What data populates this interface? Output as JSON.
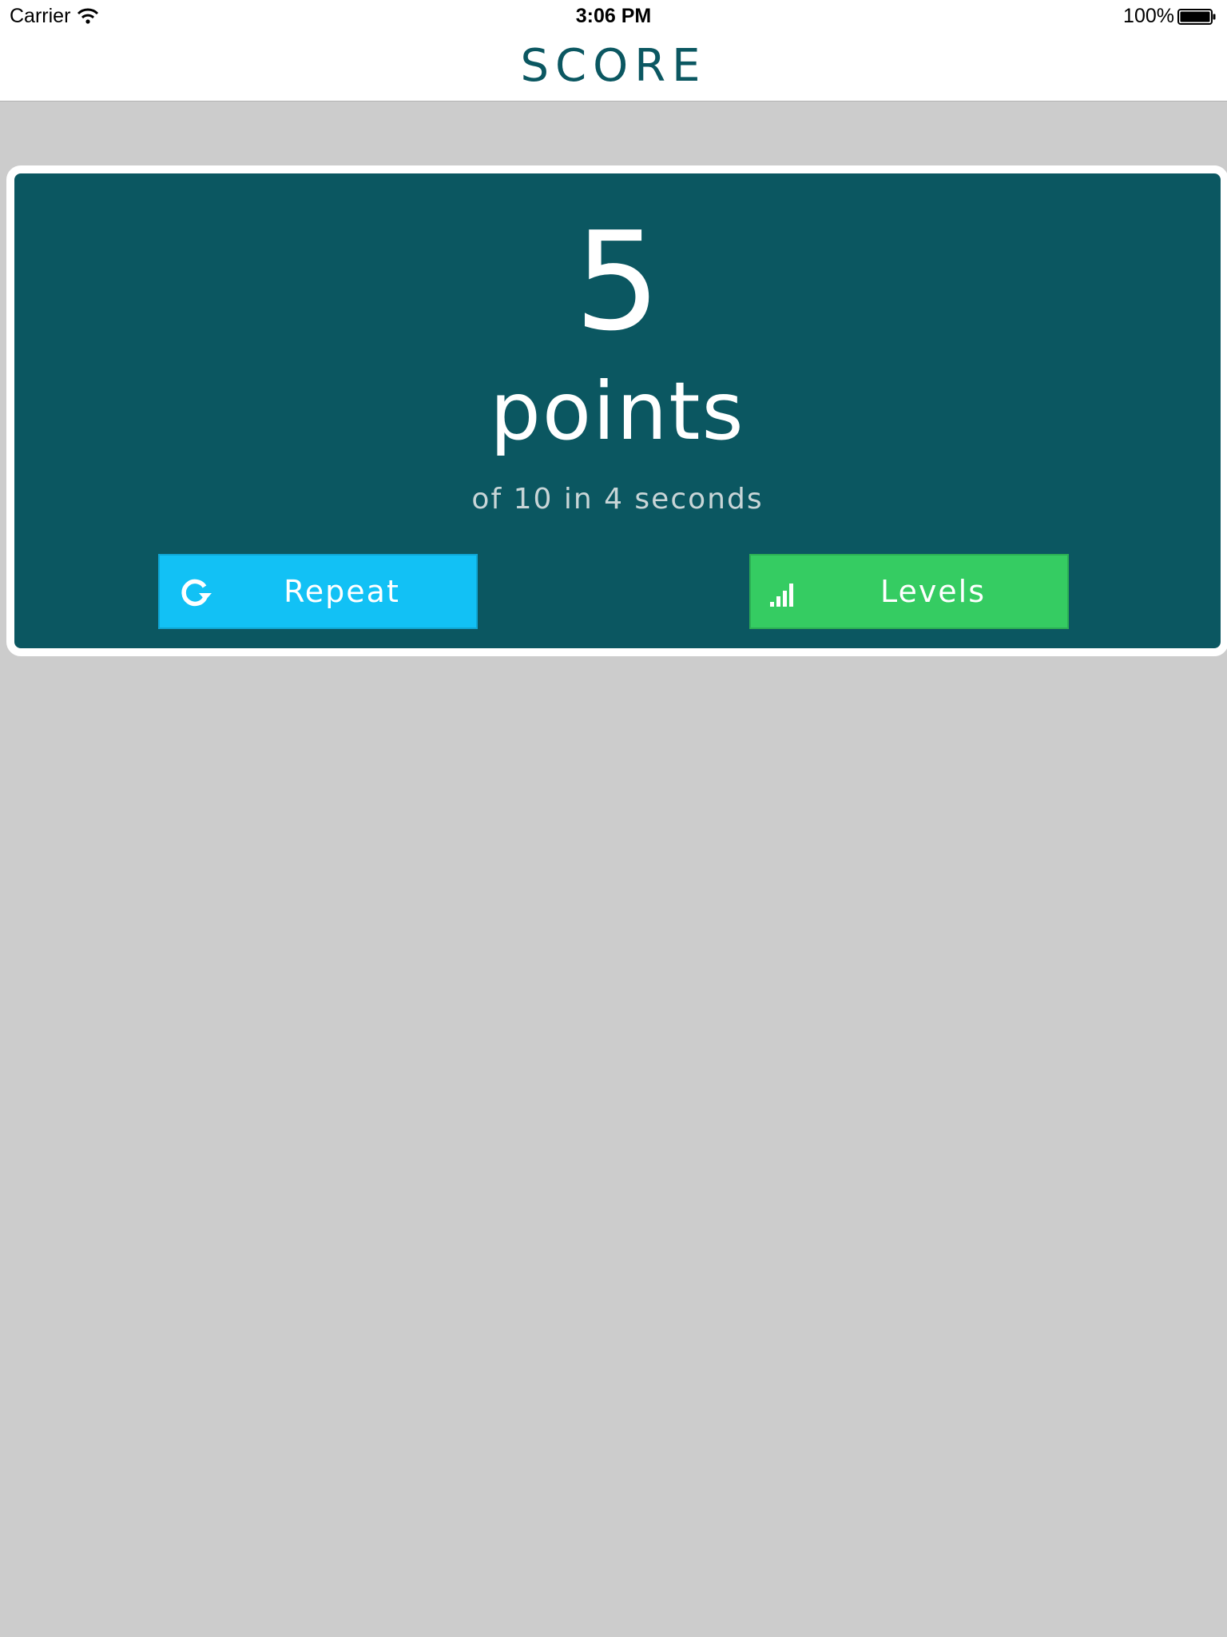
{
  "status_bar": {
    "carrier": "Carrier",
    "time": "3:06 PM",
    "battery_percent": "100%"
  },
  "nav_bar": {
    "title": "SCORE"
  },
  "score_card": {
    "score": "5",
    "unit": "points",
    "detail": "of 10 in 4 seconds"
  },
  "buttons": {
    "repeat": {
      "label": "Repeat",
      "icon": "refresh-icon",
      "color": "#12c1f5"
    },
    "levels": {
      "label": "Levels",
      "icon": "signal-bars-icon",
      "color": "#35cc62"
    }
  },
  "colors": {
    "teal": "#0b5761",
    "background": "#cccccc",
    "white": "#ffffff"
  }
}
